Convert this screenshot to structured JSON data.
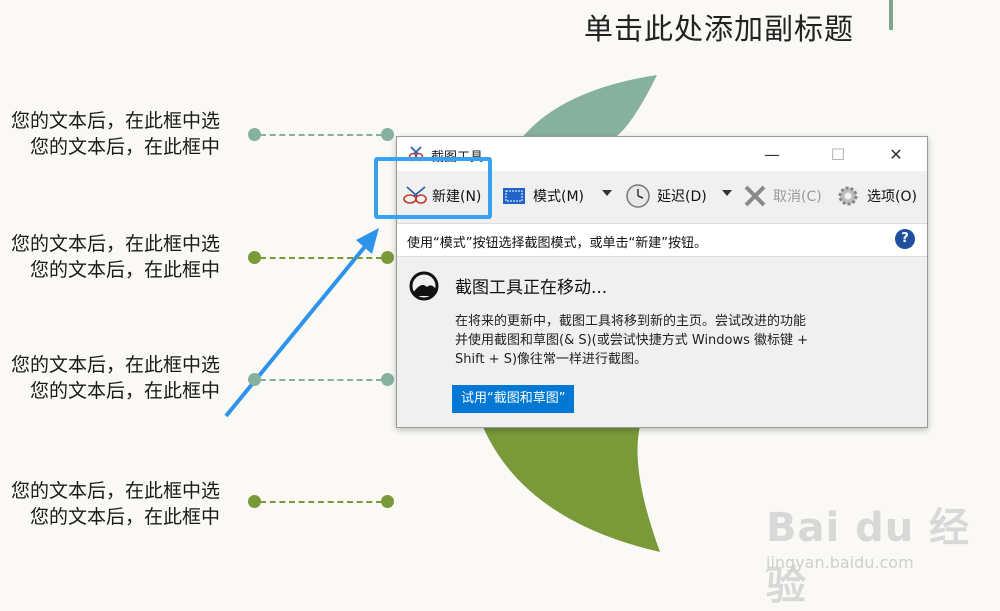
{
  "slide": {
    "subtitle": "单击此处添加副标题",
    "rows": [
      {
        "line1": "您的文本后，在此框中选",
        "line2": "您的文本后，在此框中"
      },
      {
        "line1": "您的文本后，在此框中选",
        "line2": "您的文本后，在此框中"
      },
      {
        "line1": "您的文本后，在此框中选",
        "line2": "您的文本后，在此框中"
      },
      {
        "line1": "您的文本后，在此框中选",
        "line2": "您的文本后，在此框中"
      }
    ],
    "colors": {
      "teal": "#86b0a0",
      "olive": "#7a9a3a"
    }
  },
  "window": {
    "title": "截图工具",
    "controls": {
      "minimize": "—",
      "maximize": "☐",
      "close": "✕"
    },
    "toolbar": {
      "new_label": "新建(N)",
      "mode_label": "模式(M)",
      "delay_label": "延迟(D)",
      "cancel_label": "取消(C)",
      "options_label": "选项(O)"
    },
    "info_text": "使用“模式”按钮选择截图模式，或单击“新建”按钮。",
    "help_label": "?",
    "moving": {
      "heading": "截图工具正在移动...",
      "desc_line1": "在将来的更新中，截图工具将移到新的主页。尝试改进的功能",
      "desc_line2": "并使用截图和草图(& S)(或尝试快捷方式 Windows 徽标键 +",
      "desc_line3": "Shift + S)像往常一样进行截图。",
      "try_button": "试用“截图和草图”"
    }
  },
  "watermark": {
    "brand": "Bai  du 经验",
    "url": "jingyan.baidu.com"
  }
}
